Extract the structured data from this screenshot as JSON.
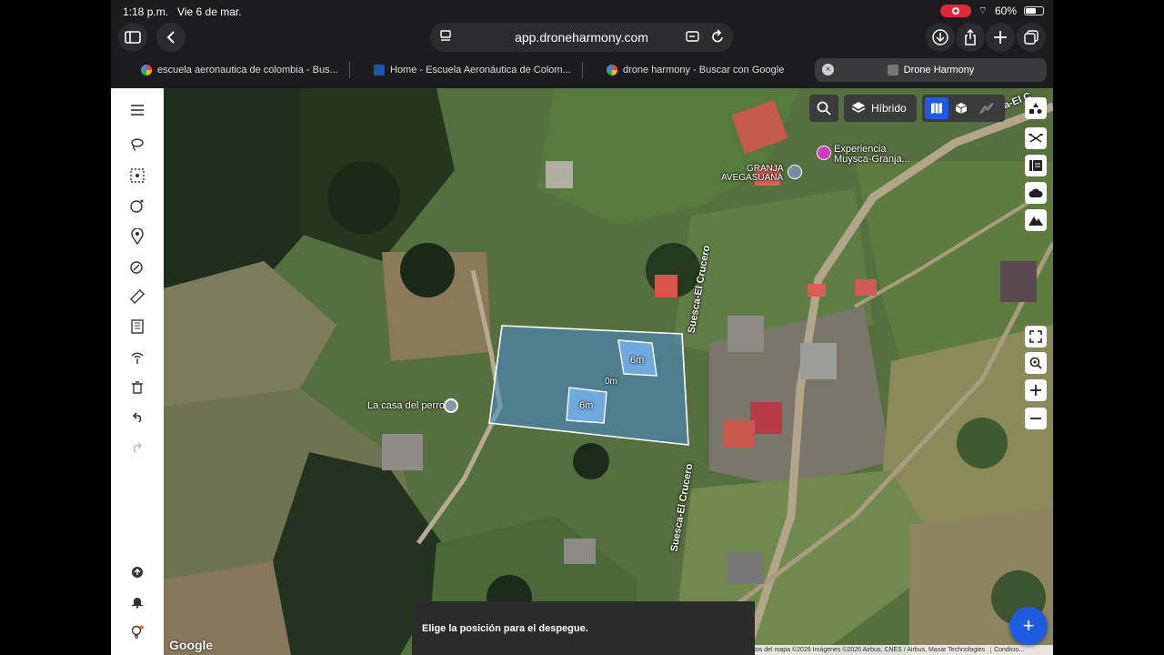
{
  "status": {
    "time": "1:18 p.m.",
    "date": "Vie 6 de mar.",
    "battery": "60%",
    "battery_level": 0.6
  },
  "toolbar": {
    "url": "app.droneharmony.com"
  },
  "tabs": [
    {
      "label": "escuela aeronautica de colombia - Bus...",
      "favicon": "google-icon"
    },
    {
      "label": "Home - Escuela Aeronáutica de Colom...",
      "favicon": "site-icon"
    },
    {
      "label": "drone harmony  - Buscar con Google",
      "favicon": "google-icon"
    },
    {
      "label": "Drone Harmony",
      "favicon": "droneharmony-icon",
      "active": true
    }
  ],
  "map": {
    "layer_label": "Híbrido",
    "labels": {
      "experiencia": "Experiencia Muysca-Granja...",
      "granja_1": "GRANJA",
      "granja_2": "AVEGASUANA",
      "road_top": "Suesca-El C",
      "road_mid": "Suesca-El Crucero",
      "road_low": "Suesca-El Crucero",
      "casa": "La casa del perro"
    },
    "mission": {
      "obstacle_a": "6m",
      "obstacle_b": "6m",
      "center": "0m"
    },
    "snackbar": "Elige la posición para el despegue.",
    "attribution": "Datos del mapa ©2026 Imágenes ©2026 Airbus, CNES / Airbus, Maxar Technologies",
    "conditions": "Condicio...",
    "google": "Google",
    "fab": "+"
  },
  "colors": {
    "accent": "#1e5be0",
    "record": "#e0263a"
  }
}
